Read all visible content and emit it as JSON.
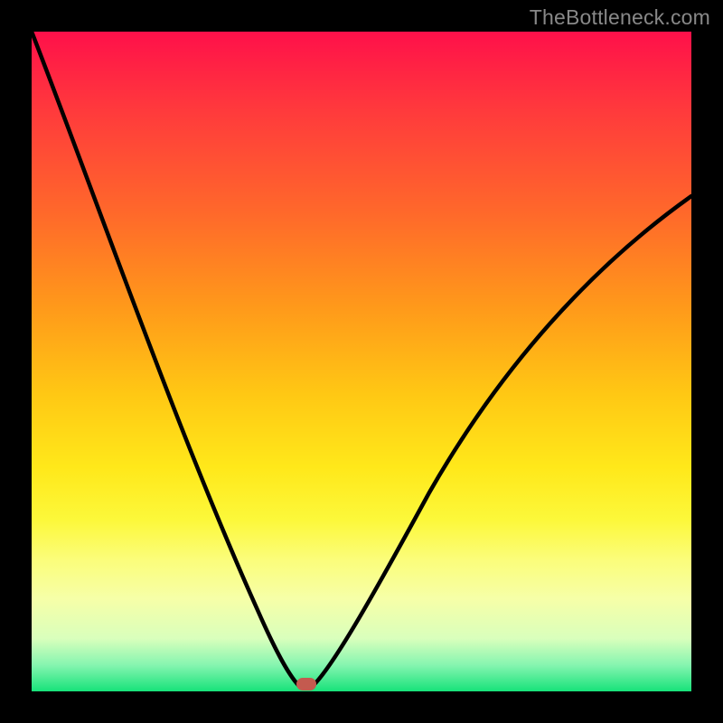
{
  "watermark_text": "TheBottleneck.com",
  "chart_data": {
    "type": "line",
    "title": "",
    "xlabel": "",
    "ylabel": "",
    "x_range_percent": [
      0,
      100
    ],
    "y_range_percent": [
      0,
      100
    ],
    "background_gradient": {
      "orientation": "top-to-bottom",
      "stops": [
        {
          "pct": 0,
          "color": "#ff104a"
        },
        {
          "pct": 40,
          "color": "#ff8a1e"
        },
        {
          "pct": 68,
          "color": "#ffe81a"
        },
        {
          "pct": 86,
          "color": "#f6ffa8"
        },
        {
          "pct": 100,
          "color": "#17e27a"
        }
      ]
    },
    "series": [
      {
        "name": "bottleneck-curve",
        "x_percent": [
          0,
          5,
          10,
          15,
          20,
          25,
          30,
          35,
          38,
          40,
          42,
          44,
          50,
          55,
          60,
          65,
          70,
          75,
          80,
          85,
          90,
          95,
          100
        ],
        "y_percent": [
          100,
          89,
          78,
          66,
          54,
          42,
          29,
          15,
          5,
          0,
          0,
          3,
          14,
          24,
          32,
          40,
          47,
          53,
          59,
          64,
          68,
          72,
          75
        ]
      }
    ],
    "marker": {
      "x_percent": 41,
      "y_percent": 0,
      "color": "#c45a4f"
    }
  }
}
